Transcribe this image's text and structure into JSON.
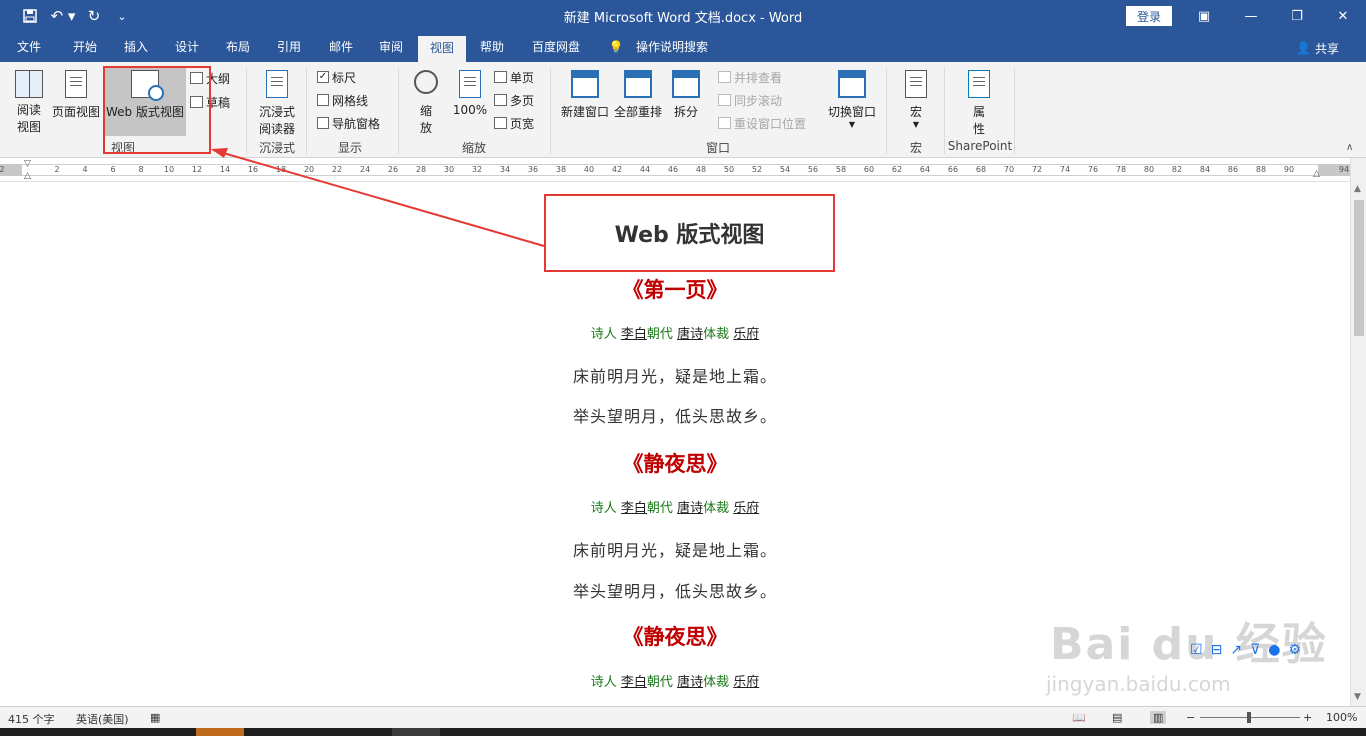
{
  "titlebar": {
    "title": "新建 Microsoft Word 文档.docx  -  Word",
    "login": "登录",
    "save_icon": "save-icon",
    "undo_icon": "undo-icon",
    "redo_icon": "redo-icon"
  },
  "tabs": [
    "文件",
    "开始",
    "插入",
    "设计",
    "布局",
    "引用",
    "邮件",
    "审阅",
    "视图",
    "帮助",
    "百度网盘",
    "操作说明搜索"
  ],
  "active_tab": "视图",
  "share": "共享",
  "ribbon": {
    "views": {
      "read": "阅读\n视图",
      "read_l1": "阅读",
      "read_l2": "视图",
      "print": "页面视图",
      "web": "Web 版式视图",
      "outline": "大纲",
      "draft": "草稿",
      "group": "视图"
    },
    "immersive": {
      "l1": "沉浸式",
      "l2": "阅读器",
      "group": "沉浸式"
    },
    "show": {
      "ruler": "标尺",
      "grid": "网格线",
      "nav": "导航窗格",
      "group": "显示"
    },
    "zoom": {
      "zoom_l1": "缩",
      "zoom_l2": "放",
      "pct": "100%",
      "one": "单页",
      "multi": "多页",
      "width": "页宽",
      "group": "缩放"
    },
    "window": {
      "new": "新建窗口",
      "arrange": "全部重排",
      "split": "拆分",
      "side": "并排查看",
      "sync": "同步滚动",
      "reset": "重设窗口位置",
      "switch": "切换窗口",
      "group": "窗口"
    },
    "macro": {
      "label": "宏",
      "group": "宏"
    },
    "sp": {
      "l1": "属",
      "l2": "性",
      "group": "SharePoint"
    }
  },
  "ruler_ticks": [
    "2",
    "2",
    "4",
    "6",
    "8",
    "10",
    "12",
    "14",
    "16",
    "18",
    "20",
    "22",
    "24",
    "26",
    "28",
    "30",
    "32",
    "34",
    "36",
    "38",
    "40",
    "42",
    "44",
    "46",
    "48",
    "50",
    "52",
    "54",
    "56",
    "58",
    "60",
    "62",
    "64",
    "66",
    "68",
    "70",
    "72",
    "74",
    "76",
    "78",
    "80",
    "82",
    "84",
    "86",
    "88",
    "90",
    "94"
  ],
  "callout": "Web 版式视图",
  "document": [
    {
      "title": "《第一页》",
      "meta": [
        "诗人",
        "李白",
        "朝代",
        "唐诗",
        "体裁",
        "乐府"
      ],
      "lines": [
        "床前明月光，疑是地上霜。",
        "举头望明月，低头思故乡。"
      ]
    },
    {
      "title": "《静夜思》",
      "meta": [
        "诗人",
        "李白",
        "朝代",
        "唐诗",
        "体裁",
        "乐府"
      ],
      "lines": [
        "床前明月光，疑是地上霜。",
        "举头望明月，低头思故乡。"
      ]
    },
    {
      "title": "《静夜思》",
      "meta": [
        "诗人",
        "李白",
        "朝代",
        "唐诗",
        "体裁",
        "乐府"
      ]
    }
  ],
  "status": {
    "words": "415 个字",
    "lang": "英语(美国)",
    "zoom": "100%"
  },
  "watermark": {
    "brand": "Bai du 经验",
    "url": "jingyan.baidu.com"
  }
}
